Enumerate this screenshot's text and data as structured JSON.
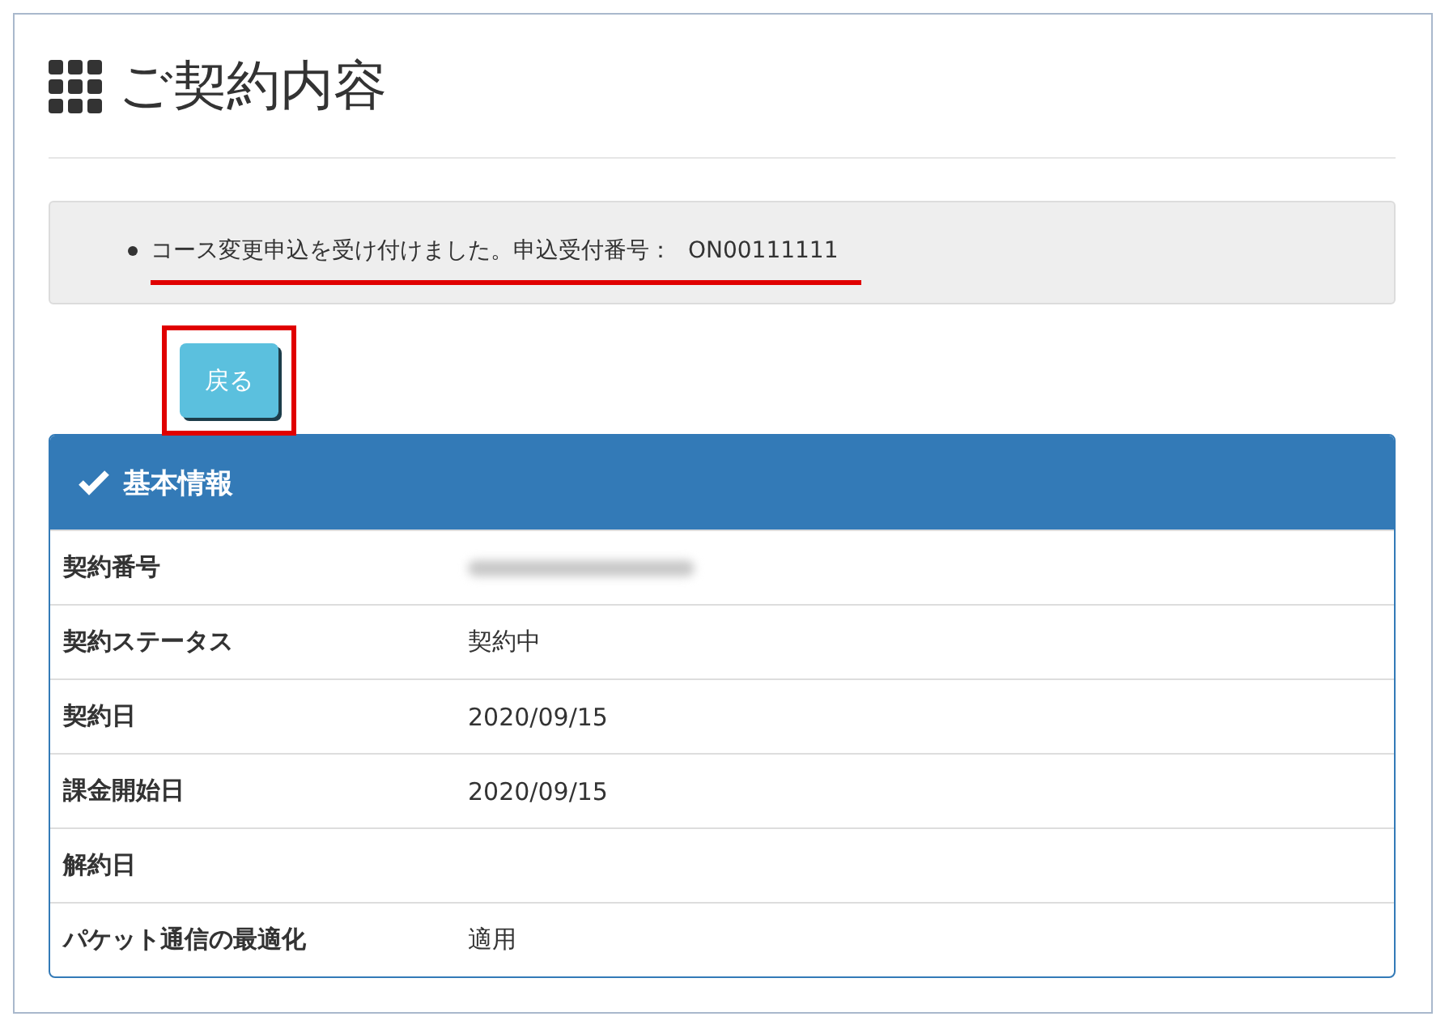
{
  "page": {
    "title": "ご契約内容"
  },
  "message": {
    "text": "コース変更申込を受け付けました。申込受付番号：",
    "number": "ON00111111",
    "highlighted": true
  },
  "back_button": {
    "label": "戻る",
    "highlighted": true
  },
  "panel": {
    "title": "基本情報",
    "rows": [
      {
        "label": "契約番号",
        "kind": "redacted"
      },
      {
        "label": "契約ステータス",
        "kind": "text",
        "value": "契約中"
      },
      {
        "label": "契約日",
        "kind": "text",
        "value": "2020/09/15"
      },
      {
        "label": "課金開始日",
        "kind": "text",
        "value": "2020/09/15"
      },
      {
        "label": "解約日",
        "kind": "empty"
      },
      {
        "label": "パケット通信の最適化",
        "kind": "text",
        "value": "適用"
      }
    ]
  }
}
